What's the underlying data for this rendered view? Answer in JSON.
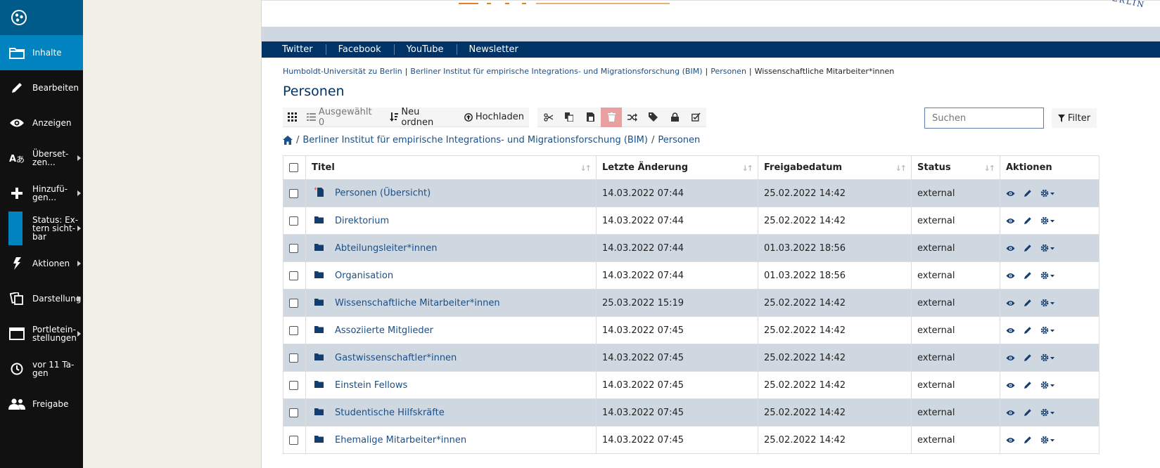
{
  "toolbar": {
    "items": [
      {
        "label": "Inhalte",
        "icon": "folder-icon",
        "active": true,
        "arrow": false
      },
      {
        "label": "Bearbeiten",
        "icon": "pencil-icon",
        "active": false,
        "arrow": false
      },
      {
        "label": "Anzeigen",
        "icon": "eye-icon",
        "active": false,
        "arrow": false
      },
      {
        "label": "Überset-zen...",
        "icon": "translate-icon",
        "active": false,
        "arrow": true
      },
      {
        "label": "Hinzufü-gen...",
        "icon": "plus-icon",
        "active": false,
        "arrow": true
      },
      {
        "label": "Status: Ex-tern sicht-bar",
        "icon": "status-swatch",
        "active": false,
        "arrow": true
      },
      {
        "label": "Aktionen",
        "icon": "bolt-icon",
        "active": false,
        "arrow": true
      },
      {
        "label": "Darstellung",
        "icon": "display-icon",
        "active": false,
        "arrow": true
      },
      {
        "label": "Portletein-stellungen",
        "icon": "window-icon",
        "active": false,
        "arrow": true
      },
      {
        "label": "vor 11 Ta-gen",
        "icon": "clock-icon",
        "active": false,
        "arrow": false
      },
      {
        "label": "Freigabe",
        "icon": "users-icon",
        "active": false,
        "arrow": false
      }
    ]
  },
  "nav": [
    "Twitter",
    "Facebook",
    "YouTube",
    "Newsletter"
  ],
  "header": {
    "uni_text": "ZU BERLIN"
  },
  "breadcrumbs": [
    "Humboldt-Universität zu Berlin",
    "Berliner Institut für empirische Integrations- und Migrationsforschung (BIM)",
    "Personen",
    "Wissenschaftliche Mitarbeiter*innen"
  ],
  "page_title": "Personen",
  "structure": {
    "selected": "Ausgewählt 0",
    "reorder": "Neu ordnen",
    "upload": "Hochladen",
    "search_placeholder": "Suchen",
    "filter": "Filter"
  },
  "path": [
    "Berliner Institut für empirische Integrations- und Migrationsforschung (BIM)",
    "Personen"
  ],
  "table": {
    "headers": [
      "Titel",
      "Letzte Änderung",
      "Freigabedatum",
      "Status",
      "Aktionen"
    ],
    "rows": [
      {
        "title": "Personen (Übersicht)",
        "type": "document",
        "modified": "14.03.2022 07:44",
        "effective": "25.02.2022 14:42",
        "status": "external"
      },
      {
        "title": "Direktorium",
        "type": "folder",
        "modified": "14.03.2022 07:44",
        "effective": "25.02.2022 14:42",
        "status": "external"
      },
      {
        "title": "Abteilungsleiter*innen",
        "type": "folder",
        "modified": "14.03.2022 07:44",
        "effective": "01.03.2022 18:56",
        "status": "external"
      },
      {
        "title": "Organisation",
        "type": "folder",
        "modified": "14.03.2022 07:44",
        "effective": "01.03.2022 18:56",
        "status": "external"
      },
      {
        "title": "Wissenschaftliche Mitarbeiter*innen",
        "type": "folder",
        "modified": "25.03.2022 15:19",
        "effective": "25.02.2022 14:42",
        "status": "external"
      },
      {
        "title": "Assoziierte Mitglieder",
        "type": "folder",
        "modified": "14.03.2022 07:45",
        "effective": "25.02.2022 14:42",
        "status": "external"
      },
      {
        "title": "Gastwissenschaftler*innen",
        "type": "folder",
        "modified": "14.03.2022 07:45",
        "effective": "25.02.2022 14:42",
        "status": "external"
      },
      {
        "title": "Einstein Fellows",
        "type": "folder",
        "modified": "14.03.2022 07:45",
        "effective": "25.02.2022 14:42",
        "status": "external"
      },
      {
        "title": "Studentische Hilfskräfte",
        "type": "folder",
        "modified": "14.03.2022 07:45",
        "effective": "25.02.2022 14:42",
        "status": "external"
      },
      {
        "title": "Ehemalige Mitarbeiter*innen",
        "type": "folder",
        "modified": "14.03.2022 07:45",
        "effective": "25.02.2022 14:42",
        "status": "external"
      }
    ]
  },
  "colors": {
    "toolbar_bg": "#111111",
    "toolbar_active": "#0083be",
    "nav_bg": "#003366",
    "link": "#1b4f86",
    "row_odd": "#cfd7e0",
    "delete_bg": "#e8a0a0"
  }
}
